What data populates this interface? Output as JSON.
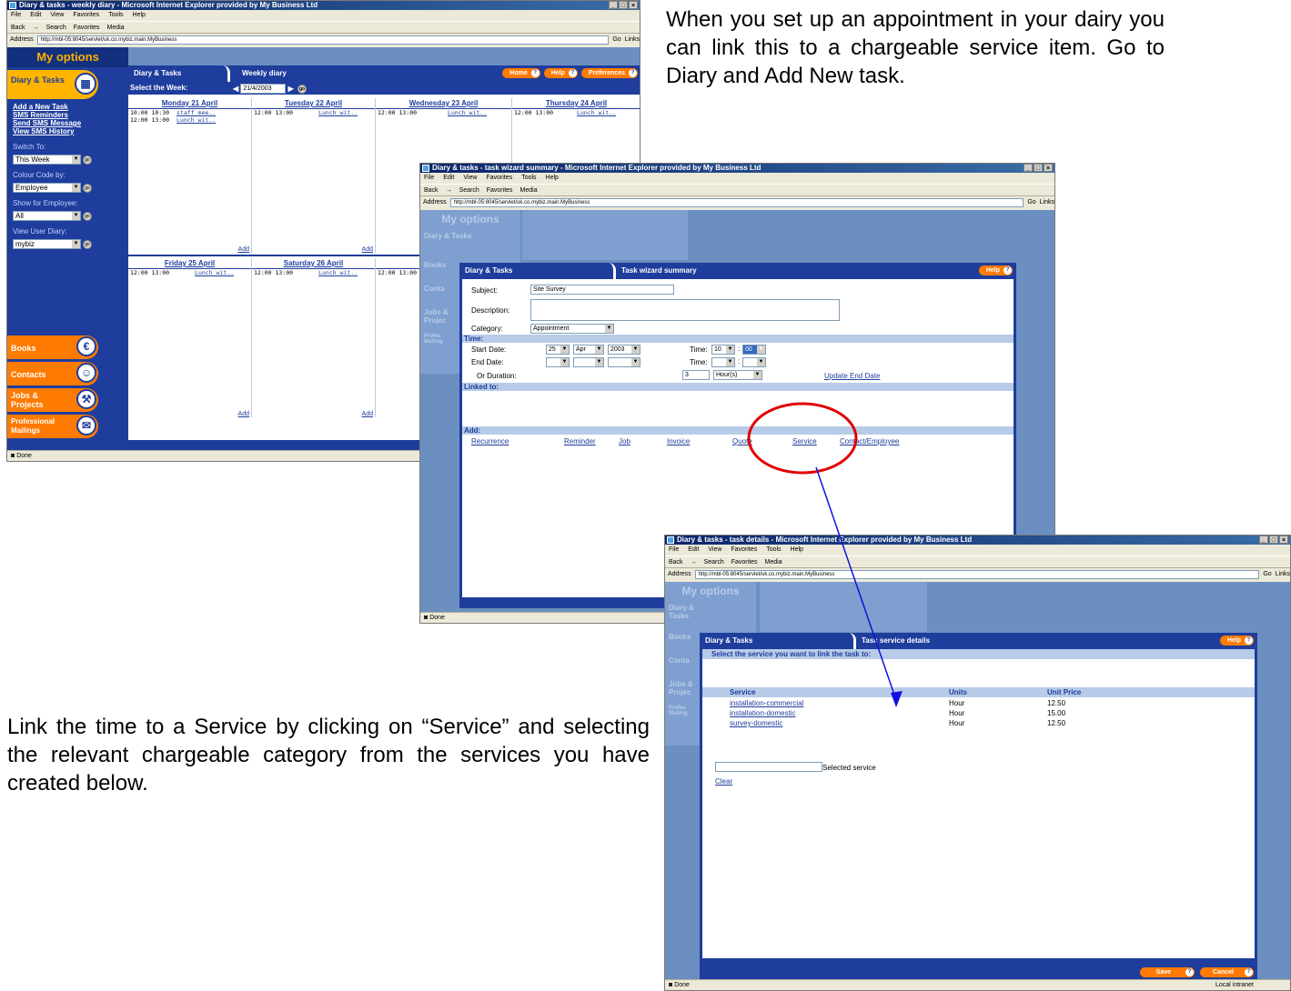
{
  "callouts": {
    "top": "When you set up an appointment in your dairy you can link this to a chargeable service item.  Go to Diary and Add New task.",
    "bottom": "Link the time to a Service by clicking on “Service” and selecting the relevant chargeable category from the services you have created below."
  },
  "browser": {
    "menu": [
      "File",
      "Edit",
      "View",
      "Favorites",
      "Tools",
      "Help"
    ],
    "toolbar": [
      "Back",
      "→",
      "Search",
      "Favorites",
      "Media"
    ],
    "address_label": "Address",
    "url": "http://mbl-05:8045/servlet/uk.co.mybiz.main.MyBusiness",
    "go_label": "Go",
    "links_label": "Links",
    "status": "Done",
    "zone": "Local intranet"
  },
  "win1": {
    "title": "Diary & tasks - weekly diary - Microsoft Internet Explorer provided by My Business Ltd",
    "sidebar": {
      "header": "My options",
      "active": "Diary & Tasks",
      "links": [
        "Add a New Task",
        "SMS Reminders",
        "Send SMS Message",
        "View SMS History"
      ],
      "switch_label": "Switch To:",
      "switch_value": "This Week",
      "colour_label": "Colour Code by:",
      "colour_value": "Employee",
      "show_label": "Show for Employee:",
      "show_value": "All",
      "user_label": "View User Diary:",
      "user_value": "mybiz",
      "items": [
        "Books",
        "Contacts",
        "Jobs & Projects",
        "Professional Mailings"
      ]
    },
    "tabs": {
      "left": "Diary & Tasks",
      "right": "Weekly diary"
    },
    "buttons": {
      "home": "Home",
      "help": "Help",
      "prefs": "Preferences"
    },
    "week_label": "Select the Week:",
    "week_value": "21/4/2003",
    "add_label": "Add",
    "days_row1": [
      {
        "name": "Monday 21 April",
        "entries": [
          {
            "time": "10:00 10:30",
            "text": "staff mee.."
          },
          {
            "time": "12:00 13:00",
            "text": "Lunch wit.."
          }
        ]
      },
      {
        "name": "Tuesday 22 April",
        "entries": [
          {
            "time": "12:00 13:00",
            "text": "Lunch wit.."
          }
        ]
      },
      {
        "name": "Wednesday 23 April",
        "entries": [
          {
            "time": "12:00 13:00",
            "text": "Lunch wit.."
          }
        ]
      },
      {
        "name": "Thursday 24 April",
        "entries": [
          {
            "time": "12:00 13:00",
            "text": "Lunch wit.."
          }
        ]
      }
    ],
    "days_row2": [
      {
        "name": "Friday 25 April",
        "entries": [
          {
            "time": "12:00 13:00",
            "text": "Lunch wit.."
          }
        ]
      },
      {
        "name": "Saturday 26 April",
        "entries": [
          {
            "time": "12:00 13:00",
            "text": "Lunch wit.."
          }
        ]
      },
      {
        "name": "Su",
        "entries": [
          {
            "time": "12:00 13:00",
            "text": ""
          }
        ]
      }
    ]
  },
  "win2": {
    "title": "Diary & tasks - task wizard summary - Microsoft Internet Explorer provided by My Business Ltd",
    "sidebar_header": "My options",
    "sidebar_items": [
      "Diary & Tasks",
      "Books",
      "Conta",
      "Jobs & Projec",
      "Profes Mailing"
    ],
    "tabs": {
      "left": "Diary & Tasks",
      "right": "Task wizard summary"
    },
    "help": "Help",
    "subject_label": "Subject:",
    "subject_value": "Site Survey",
    "description_label": "Description:",
    "category_label": "Category:",
    "category_value": "Appointment",
    "time_band": "Time:",
    "start_label": "Start Date:",
    "start_day": "25",
    "start_month": "Apr",
    "start_year": "2003",
    "time_label": "Time:",
    "start_hour": "10",
    "start_min": "00",
    "end_label": "End Date:",
    "duration_label": "Or Duration:",
    "duration_value": "3",
    "duration_unit": "Hour(s)",
    "update_end": "Update End Date",
    "linked_band": "Linked to:",
    "add_band": "Add:",
    "add_links": [
      "Recurrence",
      "Reminder",
      "Job",
      "Invoice",
      "Quote",
      "Service",
      "Contact/Employee"
    ]
  },
  "win3": {
    "title": "Diary & tasks - task details - Microsoft Internet Explorer provided by My Business Ltd",
    "sidebar_header": "My options",
    "sidebar_items": [
      "Diary & Tasks",
      "Books",
      "Conta",
      "Jobs & Projec",
      "Profes Mailing"
    ],
    "tabs": {
      "left": "Diary & Tasks",
      "right": "Task service details"
    },
    "help": "Help",
    "instruction": "Select the service you want to link the task to:",
    "columns": [
      "Service",
      "Units",
      "Unit Price"
    ],
    "rows": [
      {
        "service": "installation-commercial",
        "units": "Hour",
        "price": "12.50"
      },
      {
        "service": "installation-domestic",
        "units": "Hour",
        "price": "15.00"
      },
      {
        "service": "survey-domestic",
        "units": "Hour",
        "price": "12.50"
      }
    ],
    "selected_label": "Selected service",
    "clear": "Clear",
    "save": "Save",
    "cancel": "Cancel"
  },
  "colors": {
    "navy": "#1e3d9c",
    "orange": "#ff7a00",
    "annotation_red": "#e00000",
    "arrow_blue": "#1010e0"
  }
}
